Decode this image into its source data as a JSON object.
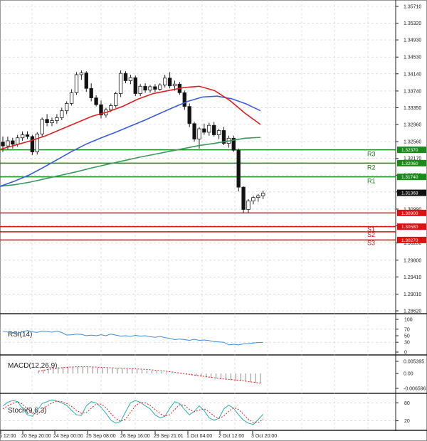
{
  "chart_data": {
    "type": "candlestick",
    "main": {
      "price_ticks": [
        "1.35710",
        "1.35320",
        "1.34930",
        "1.34530",
        "1.34140",
        "1.33740",
        "1.33350",
        "1.32960",
        "1.32560",
        "1.32170",
        "1.31780",
        "1.31390",
        "1.30990",
        "1.30600",
        "1.30200",
        "1.29800",
        "1.29410",
        "1.29010",
        "1.28620"
      ],
      "time_labels": [
        "p 12:00",
        "20 Sep 20:00",
        "24 Sep 00:00",
        "25 Sep 08:00",
        "26 Sep 16:00",
        "29 Sep 21:01",
        "1 Oct 04:00",
        "2 Oct 12:00",
        "3 Oct 20:00"
      ],
      "current_price": {
        "label": "1.31368",
        "value": 1.31368
      },
      "levels": [
        {
          "name": "R3",
          "label": "1.32370",
          "value": 1.3237,
          "color": "#1a8a1a"
        },
        {
          "name": "R2",
          "label": "1.32060",
          "value": 1.3206,
          "color": "#1a8a1a"
        },
        {
          "name": "R1",
          "label": "1.31740",
          "value": 1.3174,
          "color": "#1a8a1a"
        },
        {
          "name": "",
          "label": "1.30900",
          "value": 1.309,
          "color": "#dd1111"
        },
        {
          "name": "S1",
          "label": "1.30580",
          "value": 1.3058,
          "color": "#dd1111"
        },
        {
          "name": "S2",
          "label": "",
          "value": 1.3046,
          "color": "#dd1111"
        },
        {
          "name": "S3",
          "label": "1.30270",
          "value": 1.3027,
          "color": "#dd1111"
        }
      ],
      "candles": [
        [
          1.3255,
          1.3268,
          1.3232,
          1.3246
        ],
        [
          1.3246,
          1.3268,
          1.3238,
          1.3258
        ],
        [
          1.3258,
          1.3265,
          1.324,
          1.325
        ],
        [
          1.325,
          1.3272,
          1.3244,
          1.3265
        ],
        [
          1.3265,
          1.328,
          1.3258,
          1.3272
        ],
        [
          1.3272,
          1.328,
          1.3262,
          1.3268
        ],
        [
          1.3268,
          1.3272,
          1.3225,
          1.3232
        ],
        [
          1.3232,
          1.3278,
          1.3226,
          1.3274
        ],
        [
          1.3274,
          1.3312,
          1.3268,
          1.3308
        ],
        [
          1.3308,
          1.332,
          1.3292,
          1.33
        ],
        [
          1.33,
          1.3312,
          1.3292,
          1.3305
        ],
        [
          1.3305,
          1.332,
          1.3298,
          1.3312
        ],
        [
          1.3312,
          1.3335,
          1.3306,
          1.3328
        ],
        [
          1.3328,
          1.335,
          1.332,
          1.3345
        ],
        [
          1.3345,
          1.3378,
          1.334,
          1.337
        ],
        [
          1.337,
          1.3418,
          1.3365,
          1.3412
        ],
        [
          1.3412,
          1.3422,
          1.34,
          1.3416
        ],
        [
          1.3416,
          1.342,
          1.3372,
          1.338
        ],
        [
          1.338,
          1.3392,
          1.335,
          1.3358
        ],
        [
          1.3358,
          1.3364,
          1.3338,
          1.3342
        ],
        [
          1.3342,
          1.3352,
          1.331,
          1.3318
        ],
        [
          1.3318,
          1.3335,
          1.3312,
          1.333
        ],
        [
          1.333,
          1.3345,
          1.3325,
          1.334
        ],
        [
          1.334,
          1.3372,
          1.3335,
          1.3368
        ],
        [
          1.3368,
          1.3422,
          1.336,
          1.3415
        ],
        [
          1.3415,
          1.342,
          1.3392,
          1.3398
        ],
        [
          1.3398,
          1.3412,
          1.339,
          1.3405
        ],
        [
          1.3405,
          1.341,
          1.3362,
          1.3368
        ],
        [
          1.3368,
          1.339,
          1.3362,
          1.3385
        ],
        [
          1.3385,
          1.3392,
          1.337,
          1.3376
        ],
        [
          1.3376,
          1.3388,
          1.337,
          1.3384
        ],
        [
          1.3384,
          1.339,
          1.3372,
          1.3378
        ],
        [
          1.3378,
          1.3392,
          1.3375,
          1.3388
        ],
        [
          1.3388,
          1.3412,
          1.3382,
          1.3404
        ],
        [
          1.3404,
          1.3418,
          1.338,
          1.3386
        ],
        [
          1.3386,
          1.3398,
          1.3375,
          1.339
        ],
        [
          1.339,
          1.3395,
          1.3365,
          1.337
        ],
        [
          1.337,
          1.3375,
          1.333,
          1.3338
        ],
        [
          1.3338,
          1.3345,
          1.329,
          1.3298
        ],
        [
          1.3298,
          1.3302,
          1.3256,
          1.3262
        ],
        [
          1.3262,
          1.329,
          1.324,
          1.3286
        ],
        [
          1.3286,
          1.3298,
          1.3272,
          1.3278
        ],
        [
          1.3278,
          1.33,
          1.327,
          1.3294
        ],
        [
          1.3294,
          1.3302,
          1.3268,
          1.3272
        ],
        [
          1.3272,
          1.3286,
          1.3262,
          1.3282
        ],
        [
          1.3282,
          1.329,
          1.3248,
          1.3252
        ],
        [
          1.3252,
          1.327,
          1.3242,
          1.3264
        ],
        [
          1.3264,
          1.327,
          1.3232,
          1.3236
        ],
        [
          1.3236,
          1.324,
          1.314,
          1.315
        ],
        [
          1.315,
          1.3152,
          1.309,
          1.3098
        ],
        [
          1.3098,
          1.3122,
          1.309,
          1.3118
        ],
        [
          1.3118,
          1.313,
          1.311,
          1.3126
        ],
        [
          1.3126,
          1.3134,
          1.3116,
          1.313
        ],
        [
          1.313,
          1.3142,
          1.3122,
          1.3136
        ]
      ],
      "ma_red": [
        1.3238,
        1.3248,
        1.3258,
        1.327,
        1.3285,
        1.33,
        1.3315,
        1.3325,
        1.3338,
        1.3355,
        1.3368,
        1.3375,
        1.3382,
        1.3385,
        1.3375,
        1.3352,
        1.3322,
        1.3296
      ],
      "ma_blue": [
        1.3152,
        1.3164,
        1.3178,
        1.3196,
        1.3215,
        1.3234,
        1.3251,
        1.3265,
        1.3278,
        1.3292,
        1.3306,
        1.3321,
        1.3336,
        1.335,
        1.336,
        1.3362,
        1.3356,
        1.3344,
        1.3328
      ],
      "ma_green": [
        1.3152,
        1.3156,
        1.3162,
        1.317,
        1.3178,
        1.3186,
        1.3195,
        1.3203,
        1.3211,
        1.3219,
        1.3226,
        1.3233,
        1.324,
        1.3247,
        1.3252,
        1.3258,
        1.3264,
        1.3266
      ]
    },
    "rsi": {
      "label": "RSI(14)",
      "ticks": [
        "100",
        "70",
        "50",
        "30",
        "0"
      ],
      "values": [
        64,
        61,
        60,
        58,
        62,
        66,
        62,
        60,
        64,
        63,
        61,
        64,
        60,
        52,
        53,
        55,
        54,
        50,
        52,
        50,
        53,
        50,
        55,
        52,
        49,
        50,
        48,
        51,
        49,
        50,
        47,
        45,
        48,
        44,
        42,
        38,
        40,
        38,
        36,
        39,
        36,
        37,
        35,
        32,
        31,
        30,
        22,
        24,
        22,
        25,
        26,
        28,
        29,
        30
      ]
    },
    "macd": {
      "label": "MACD(12,26,9)",
      "ticks": [
        "0.005395",
        "0.00",
        "-0.006596"
      ],
      "histogram": [
        0.0012,
        0.0018,
        0.0022,
        0.0025,
        0.0028,
        0.003,
        0.0031,
        0.003,
        0.003,
        0.0029,
        0.0028,
        0.0027,
        0.0026,
        0.0025,
        0.0024,
        0.0023,
        0.0022,
        0.0021,
        0.002,
        0.002,
        0.0018,
        0.0016,
        0.0014,
        0.0012,
        0.001,
        0.0008,
        0.0006,
        0.0003,
        0.0001,
        -0.0002,
        -0.0005,
        -0.0008,
        -0.0011,
        -0.0014,
        -0.0017,
        -0.002,
        -0.0023,
        -0.0026,
        -0.0028,
        -0.003,
        -0.0032,
        -0.0034,
        -0.0036,
        -0.0038,
        -0.0041,
        -0.0044
      ],
      "signal": [
        0.001,
        0.0014,
        0.0018,
        0.0021,
        0.0024,
        0.0026,
        0.0028,
        0.0029,
        0.003,
        0.003,
        0.003,
        0.0029,
        0.0028,
        0.0027,
        0.0026,
        0.0025,
        0.0024,
        0.0023,
        0.0022,
        0.0021,
        0.002,
        0.0019,
        0.0018,
        0.0016,
        0.0014,
        0.0012,
        0.001,
        0.0007,
        0.0004,
        0.0001,
        -0.0002,
        -0.0005,
        -0.0008,
        -0.0011,
        -0.0014,
        -0.0017,
        -0.002,
        -0.0023,
        -0.0025,
        -0.0027,
        -0.0029,
        -0.0031,
        -0.0034,
        -0.0037,
        -0.004,
        -0.0043
      ]
    },
    "stoch": {
      "label": "Stoch(9,6,3)",
      "ticks": [
        "80",
        "20"
      ],
      "k": [
        70,
        82,
        88,
        84,
        62,
        40,
        35,
        55,
        78,
        84,
        90,
        86,
        80,
        72,
        55,
        40,
        38,
        70,
        84,
        80,
        65,
        45,
        22,
        12,
        18,
        50,
        80,
        88,
        82,
        70,
        60,
        40,
        30,
        35,
        62,
        84,
        78,
        58,
        40,
        52,
        70,
        54,
        30,
        22,
        28,
        60,
        72,
        62,
        40,
        22,
        12,
        8,
        24,
        42
      ],
      "d": [
        60,
        70,
        78,
        84,
        76,
        60,
        45,
        42,
        56,
        70,
        80,
        86,
        84,
        78,
        68,
        55,
        45,
        48,
        62,
        76,
        76,
        64,
        44,
        28,
        18,
        26,
        48,
        70,
        82,
        80,
        72,
        58,
        44,
        36,
        40,
        58,
        74,
        72,
        58,
        50,
        56,
        60,
        50,
        36,
        28,
        36,
        52,
        64,
        58,
        42,
        26,
        14,
        14,
        26
      ]
    }
  }
}
